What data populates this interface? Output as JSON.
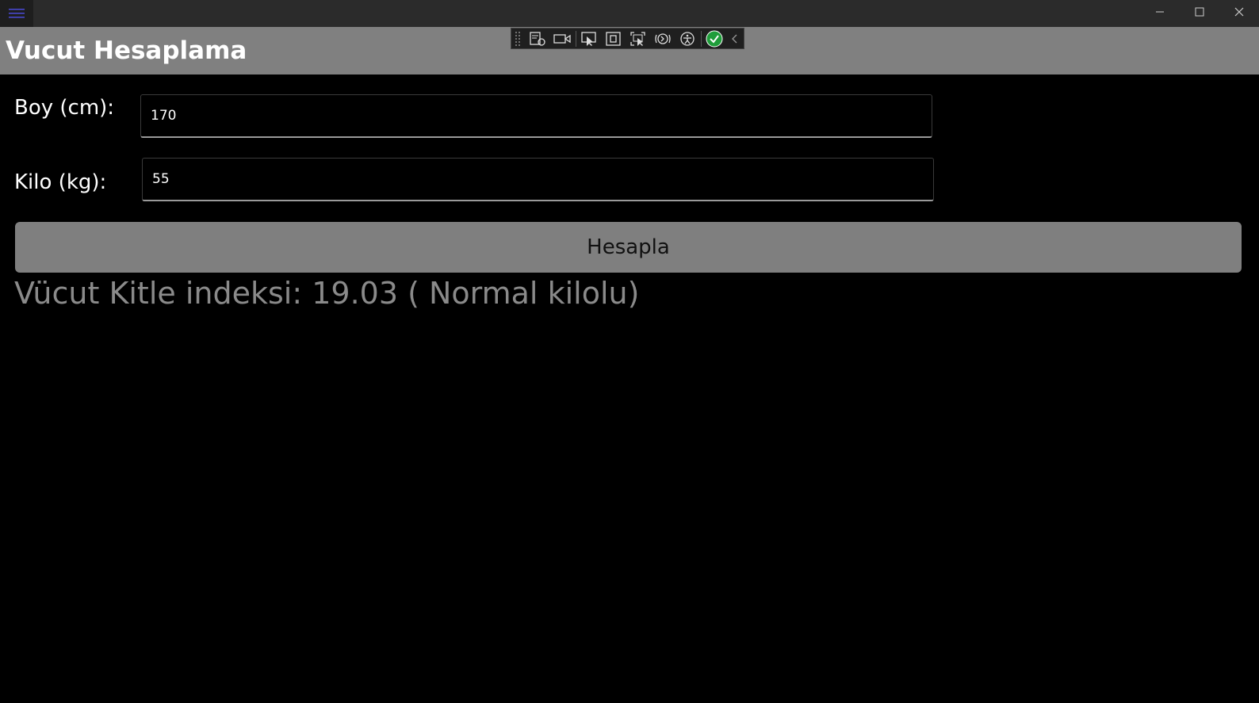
{
  "window": {
    "menu_icon": "hamburger-icon",
    "controls": [
      "minimize-icon",
      "maximize-icon",
      "close-icon"
    ]
  },
  "header": {
    "title": "Vucut Hesaplama",
    "background": "#808080"
  },
  "debug_toolbar": {
    "buttons": [
      "live-visual-tree-icon",
      "record-icon",
      "select-element-icon",
      "display-layout-adorners-icon",
      "track-focus-icon",
      "hot-reload-icon",
      "accessibility-icon",
      "status-ok-icon",
      "collapse-toolbar-icon"
    ]
  },
  "form": {
    "height_label": "Boy (cm):",
    "height_value": "170",
    "weight_label": "Kilo (kg):",
    "weight_value": "55",
    "calculate_label": "Hesapla"
  },
  "result": {
    "text": "Vücut Kitle indeksi: 19.03 ( Normal kilolu)"
  }
}
